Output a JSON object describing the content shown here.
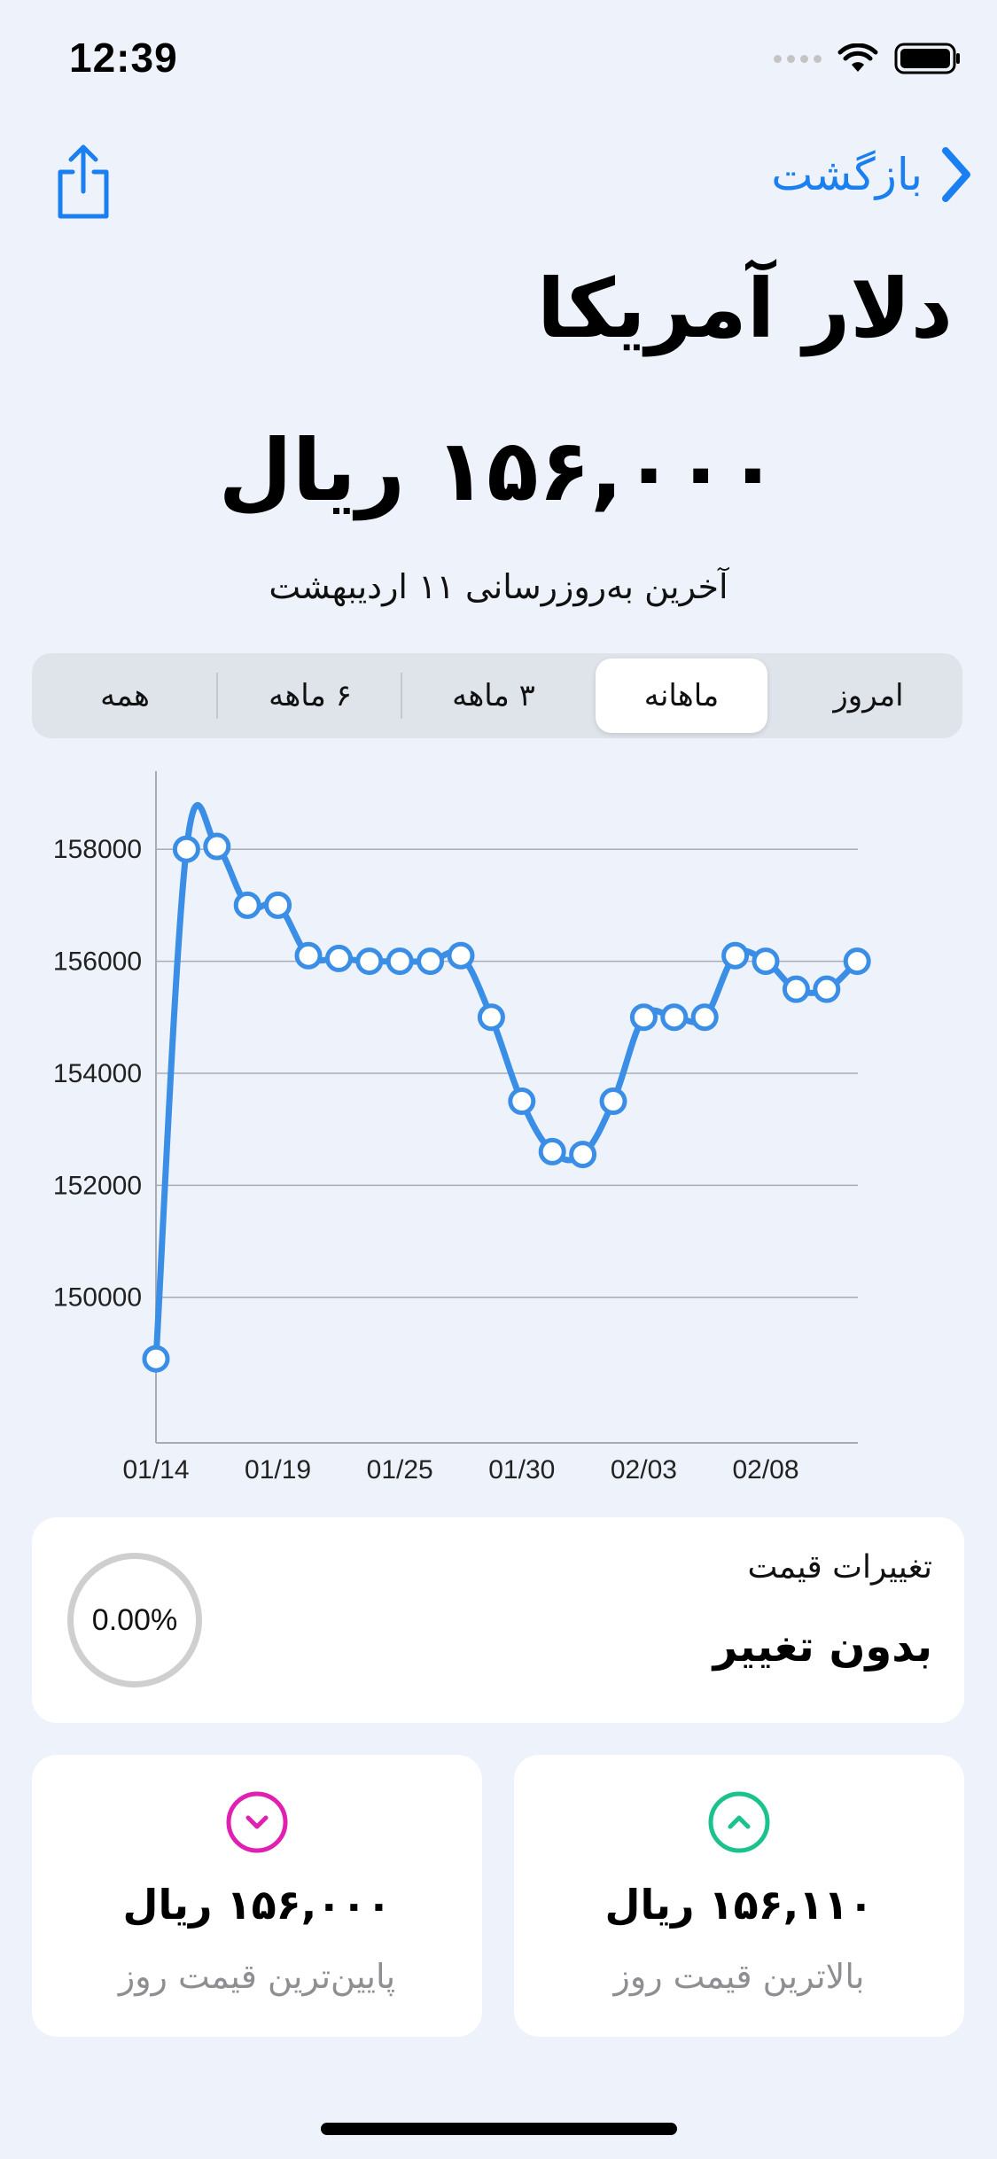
{
  "status_bar": {
    "time": "12:39"
  },
  "nav": {
    "back_label": "بازگشت",
    "share_icon": "share-icon",
    "back_icon": "chevron-right-icon"
  },
  "header": {
    "title": "دلار آمریکا",
    "price": "۱۵۶,۰۰۰ ریال",
    "updated": "آخرین به‌روزرسانی ۱۱ اردیبهشت"
  },
  "segments": [
    "امروز",
    "ماهانه",
    "۳ ماهه",
    "۶ ماهه",
    "همه"
  ],
  "selected_segment": "ماهانه",
  "chart_data": {
    "type": "line",
    "series_color": "#3a8ee6",
    "x_tick_labels": [
      "01/14",
      "01/19",
      "01/25",
      "01/30",
      "02/03",
      "02/08"
    ],
    "y_tick_labels": [
      "158000",
      "156000",
      "154000",
      "152000",
      "150000"
    ],
    "ylim": [
      147400,
      159000
    ],
    "grid": "horizontal",
    "points": [
      {
        "i": 0,
        "y": 148900
      },
      {
        "i": 1,
        "y": 158000
      },
      {
        "i": 2,
        "y": 158050
      },
      {
        "i": 3,
        "y": 157000
      },
      {
        "i": 4,
        "y": 157000
      },
      {
        "i": 5,
        "y": 156100
      },
      {
        "i": 6,
        "y": 156050
      },
      {
        "i": 7,
        "y": 156000
      },
      {
        "i": 8,
        "y": 156000
      },
      {
        "i": 9,
        "y": 156000
      },
      {
        "i": 10,
        "y": 156100
      },
      {
        "i": 11,
        "y": 155000
      },
      {
        "i": 12,
        "y": 153500
      },
      {
        "i": 13,
        "y": 152600
      },
      {
        "i": 14,
        "y": 152550
      },
      {
        "i": 15,
        "y": 153500
      },
      {
        "i": 16,
        "y": 155000
      },
      {
        "i": 17,
        "y": 155000
      },
      {
        "i": 18,
        "y": 155000
      },
      {
        "i": 19,
        "y": 156100
      },
      {
        "i": 20,
        "y": 156000
      },
      {
        "i": 21,
        "y": 155500
      },
      {
        "i": 22,
        "y": 155500
      },
      {
        "i": 23,
        "y": 156000
      }
    ],
    "x_tick_index": [
      0,
      4,
      8,
      12,
      16,
      20
    ]
  },
  "price_change": {
    "title": "تغییرات قیمت",
    "status": "بدون تغییر",
    "percent": "0.00%"
  },
  "low": {
    "value": "۱۵۶,۰۰۰ ریال",
    "label": "پایین‌ترین قیمت روز",
    "color": "#e020b0",
    "icon": "chevron-down-circle-icon"
  },
  "high": {
    "value": "۱۵۶,۱۱۰ ریال",
    "label": "بالاترین قیمت روز",
    "color": "#1cc28e",
    "icon": "chevron-up-circle-icon"
  },
  "colors": {
    "accent": "#1a7ff0",
    "background": "#eef2fa"
  }
}
